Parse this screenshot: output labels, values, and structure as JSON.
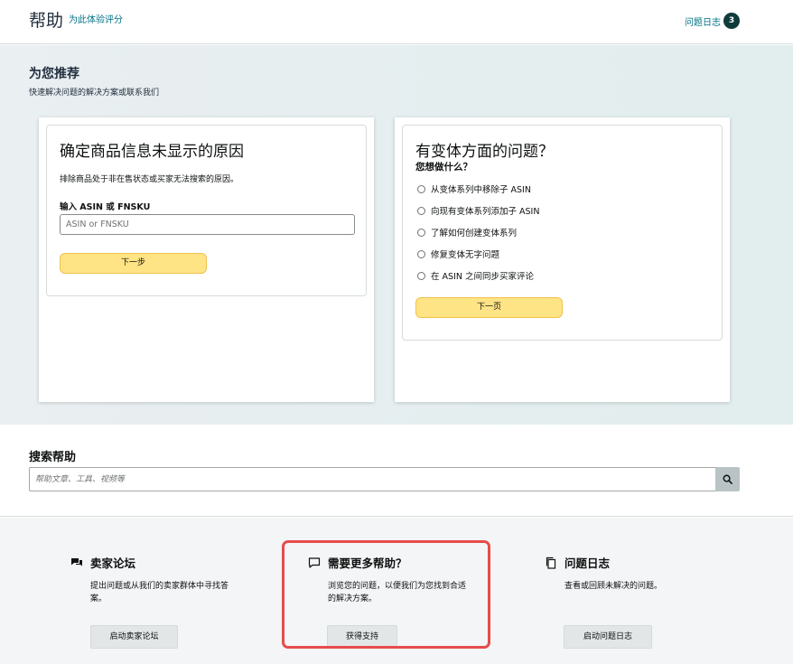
{
  "header": {
    "title": "帮助",
    "feedback_link": "为此体验评分",
    "case_log_link": "问题日志",
    "case_log_count": "3"
  },
  "recommend": {
    "title": "为您推荐",
    "subtitle": "快速解决问题的解决方案或联系我们",
    "card1": {
      "title": "确定商品信息未显示的原因",
      "description": "排除商品处于非在售状态或买家无法搜索的原因。",
      "field_label": "输入 ASIN 或 FNSKU",
      "field_placeholder": "ASIN or FNSKU",
      "button": "下一步"
    },
    "card2": {
      "title": "有变体方面的问题？",
      "question": "您想做什么？",
      "options": [
        "从变体系列中移除子 ASIN",
        "向现有变体系列添加子 ASIN",
        "了解如何创建变体系列",
        "修复变体无字问题",
        "在 ASIN 之间同步买家评论"
      ],
      "button": "下一页"
    }
  },
  "search": {
    "title": "搜索帮助",
    "placeholder": "帮助文章、工具、视频等"
  },
  "bottom": {
    "forum": {
      "title": "卖家论坛",
      "body": "提出问题或从我们的卖家群体中寻找答案。",
      "button": "启动卖家论坛"
    },
    "more_help": {
      "title": "需要更多帮助？",
      "body": "浏览您的问题，以便我们为您找到合适的解决方案。",
      "button": "获得支持"
    },
    "case_log": {
      "title": "问题日志",
      "body": "查看或回顾未解决的问题。",
      "button": "启动问题日志"
    }
  },
  "colors": {
    "accent_link": "#007185",
    "primary_button": "#ffe485",
    "highlight_border": "#e74c4c",
    "badge": "#0f3b3b"
  },
  "icons": [
    "search-icon",
    "forum-chat-icon",
    "speech-bubble-icon",
    "copy-pages-icon",
    "radio-button-icon"
  ]
}
